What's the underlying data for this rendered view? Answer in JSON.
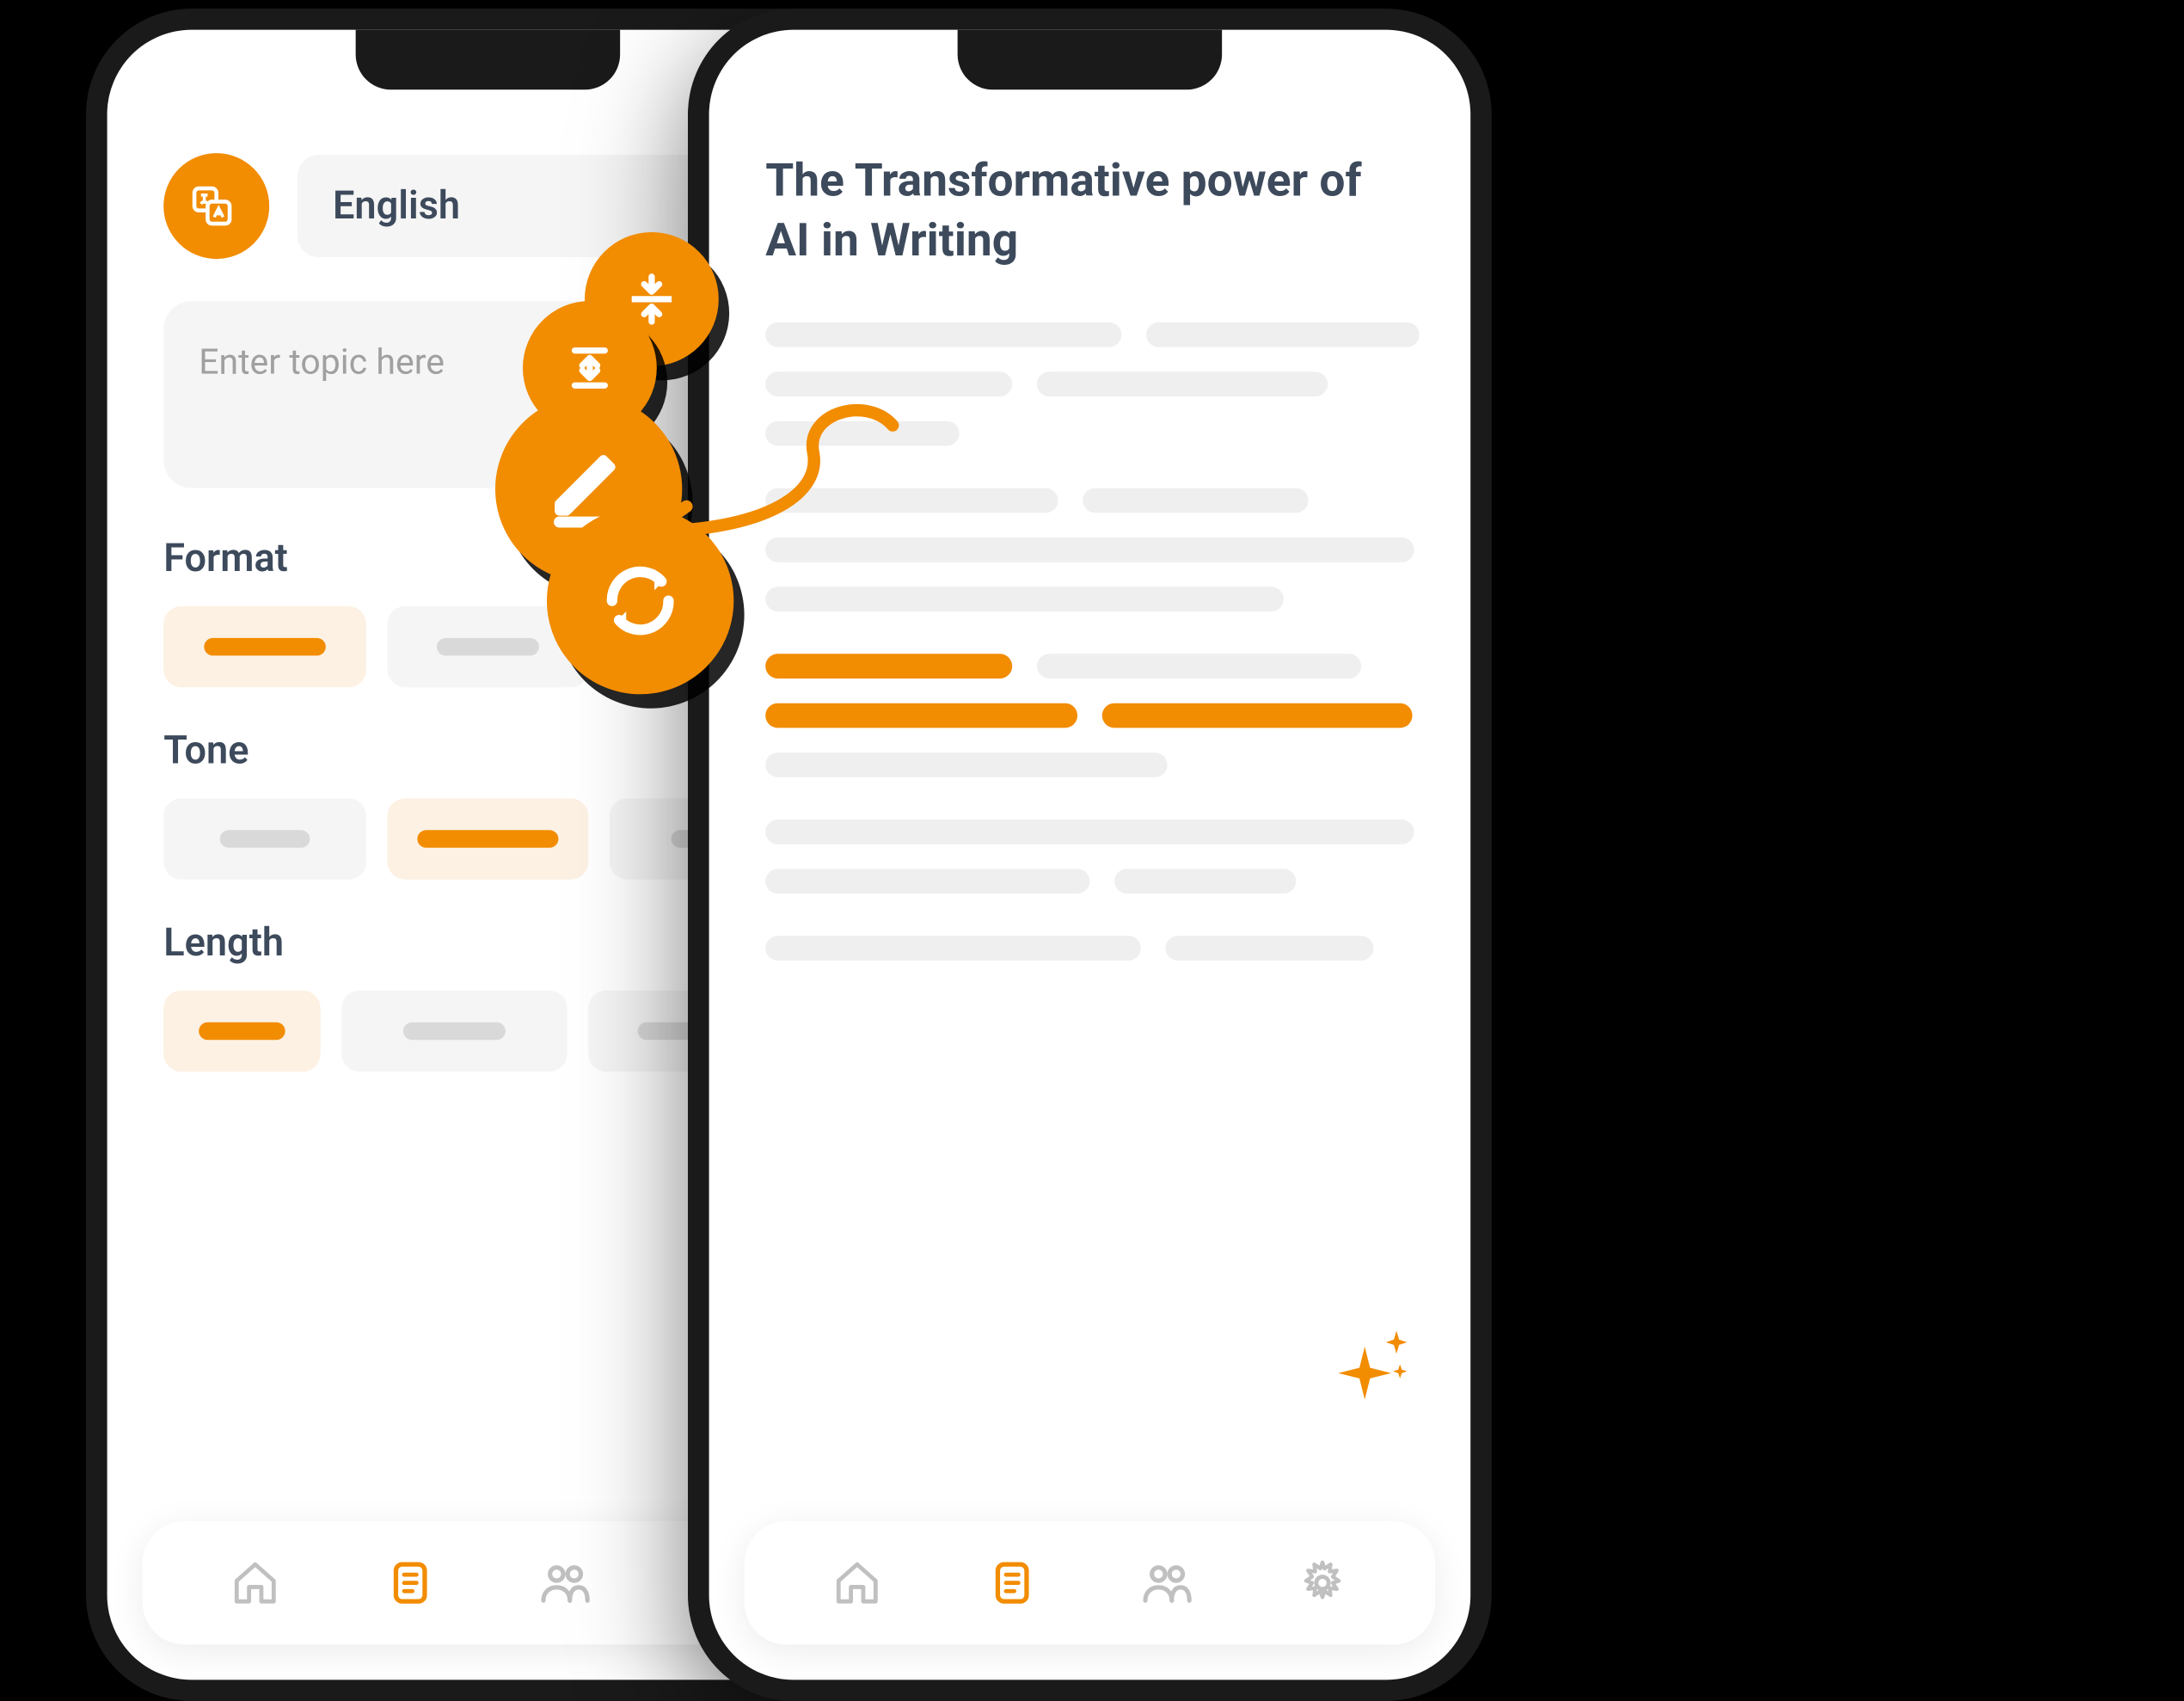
{
  "compose": {
    "language": "English",
    "topic_placeholder": "Enter topic here",
    "sections": {
      "format": "Format",
      "tone": "Tone",
      "length": "Length"
    }
  },
  "article": {
    "title": "The Transformative power of AI in Writing"
  },
  "floating_actions": {
    "compress": "compress",
    "expand": "expand",
    "edit": "edit",
    "refresh": "refresh"
  },
  "colors": {
    "accent": "#f28c00",
    "text_dark": "#3d4a5c",
    "surface": "#f5f5f5",
    "skeleton": "#efefef"
  }
}
